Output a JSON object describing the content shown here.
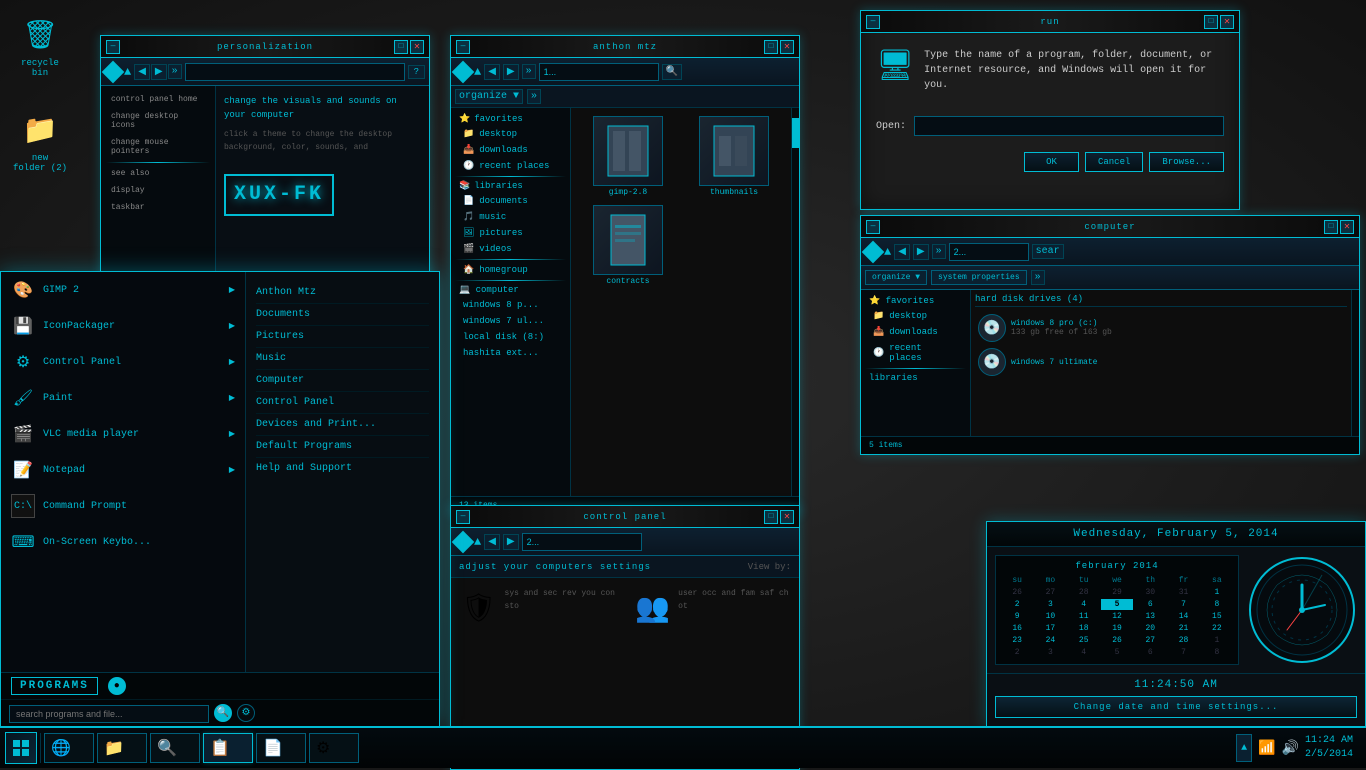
{
  "desktop": {
    "icons": [
      {
        "id": "recycle-bin",
        "label": "recycle\nbin",
        "icon": "🗑"
      },
      {
        "id": "new-folder",
        "label": "new\nfolder (2)",
        "icon": "📁"
      }
    ]
  },
  "windows": {
    "personalization": {
      "title": "personalization",
      "sidebar": {
        "items": [
          {
            "label": "control panel home",
            "active": false
          },
          {
            "label": "change desktop icons",
            "active": false
          },
          {
            "label": "change mouse pointers",
            "active": false
          }
        ],
        "see_also": "see also",
        "see_also_items": [
          "display",
          "taskbar"
        ]
      },
      "main_text": "change the visuals and sounds on your computer",
      "hint_text": "click a theme to change the desktop background, color, sounds, and",
      "logo": "XUX-FK"
    },
    "anthon_mtz": {
      "title": "anthon mtz",
      "organize_btn": "organize ▼",
      "toolbar_btn": "»",
      "favorites": {
        "label": "favorites",
        "items": [
          "desktop",
          "downloads",
          "recent places"
        ]
      },
      "libraries": {
        "label": "libraries",
        "items": [
          "documents",
          "music",
          "pictures",
          "videos"
        ]
      },
      "homegroup": "homegroup",
      "computer": "computer",
      "computer_items": [
        "windows 8 p...",
        "windows 7 ul...",
        "local disk (8:)",
        "hashita ext..."
      ],
      "status": "13 items",
      "thumbnails": [
        {
          "label": "gimp-2.8",
          "icon": "📦"
        },
        {
          "label": "thumbnails",
          "icon": "📄"
        },
        {
          "label": "contracts",
          "icon": "📋"
        }
      ]
    },
    "run": {
      "title": "run",
      "description": "Type the name of a program, folder, document, or Internet resource, and Windows will open it for you.",
      "open_label": "Open:",
      "ok_label": "OK",
      "cancel_label": "Cancel",
      "browse_label": "Browse..."
    },
    "computer": {
      "title": "computer",
      "search_placeholder": "sear",
      "organize_btn": "organize ▼",
      "sysprops_btn": "system properties",
      "toolbar_btn": "»",
      "favorites": {
        "items": [
          "desktop",
          "downloads",
          "recent places"
        ]
      },
      "hard_disk": {
        "label": "hard disk drives (4)",
        "items": [
          {
            "name": "windows 8 pro (c:)",
            "free": "133 gb free of 163 gb"
          },
          {
            "name": "windows 7 ultimate",
            "free": ""
          }
        ]
      },
      "libraries": {
        "label": "libraries"
      },
      "status": "5 items"
    },
    "control_panel": {
      "title": "control panel",
      "description": "adjust your computers settings",
      "view_by": "View by:",
      "categories": [
        {
          "icon": "🛡",
          "label": "sys and sec rev you con sto"
        },
        {
          "icon": "👥",
          "label": "user occ and fam saf ch ot"
        }
      ]
    }
  },
  "start_menu": {
    "pinned_apps": [
      {
        "label": "GIMP 2",
        "icon": "🎨"
      },
      {
        "label": "IconPackager",
        "icon": "💾"
      },
      {
        "label": "Control Panel",
        "icon": "⚙"
      },
      {
        "label": "Paint",
        "icon": "🖌"
      },
      {
        "label": "VLC media player",
        "icon": "🎬"
      },
      {
        "label": "Notepad",
        "icon": "📝"
      },
      {
        "label": "Command Prompt",
        "icon": "⬛"
      },
      {
        "label": "On-Screen Keybo...",
        "icon": "⌨"
      }
    ],
    "right_items": [
      "Anthon Mtz",
      "Documents",
      "Pictures",
      "Music",
      "Computer",
      "Control Panel",
      "Devices and Print...",
      "Default Programs",
      "Help and Support"
    ],
    "programs_label": "PROGRAMS",
    "search_placeholder": "search programs and file..."
  },
  "clock_widget": {
    "date_header": "Wednesday, February 5, 2014",
    "calendar_title": "february 2014",
    "day_headers": [
      "su",
      "mo",
      "tu",
      "we",
      "th",
      "fr",
      "sa"
    ],
    "weeks": [
      [
        "26",
        "27",
        "28",
        "29",
        "30",
        "31",
        "1"
      ],
      [
        "2",
        "3",
        "4",
        "5",
        "6",
        "7",
        "8"
      ],
      [
        "9",
        "10",
        "11",
        "12",
        "13",
        "14",
        "15"
      ],
      [
        "16",
        "17",
        "18",
        "19",
        "20",
        "21",
        "22"
      ],
      [
        "23",
        "24",
        "25",
        "26",
        "27",
        "28",
        "1"
      ],
      [
        "2",
        "3",
        "4",
        "5",
        "6",
        "7",
        "8"
      ]
    ],
    "today": "5",
    "time_digital": "11:24:50 AM",
    "change_date_btn": "Change date and time settings..."
  },
  "taskbar": {
    "items": [
      {
        "icon": "🌐",
        "active": false
      },
      {
        "icon": "📁",
        "active": false
      },
      {
        "icon": "🔍",
        "active": false
      },
      {
        "icon": "📋",
        "active": false
      },
      {
        "icon": "📄",
        "active": false
      },
      {
        "icon": "⚙",
        "active": false
      }
    ],
    "time": "11:24 AM",
    "date": "2/5/2014",
    "tray_icons": [
      "📶",
      "🔊"
    ]
  }
}
